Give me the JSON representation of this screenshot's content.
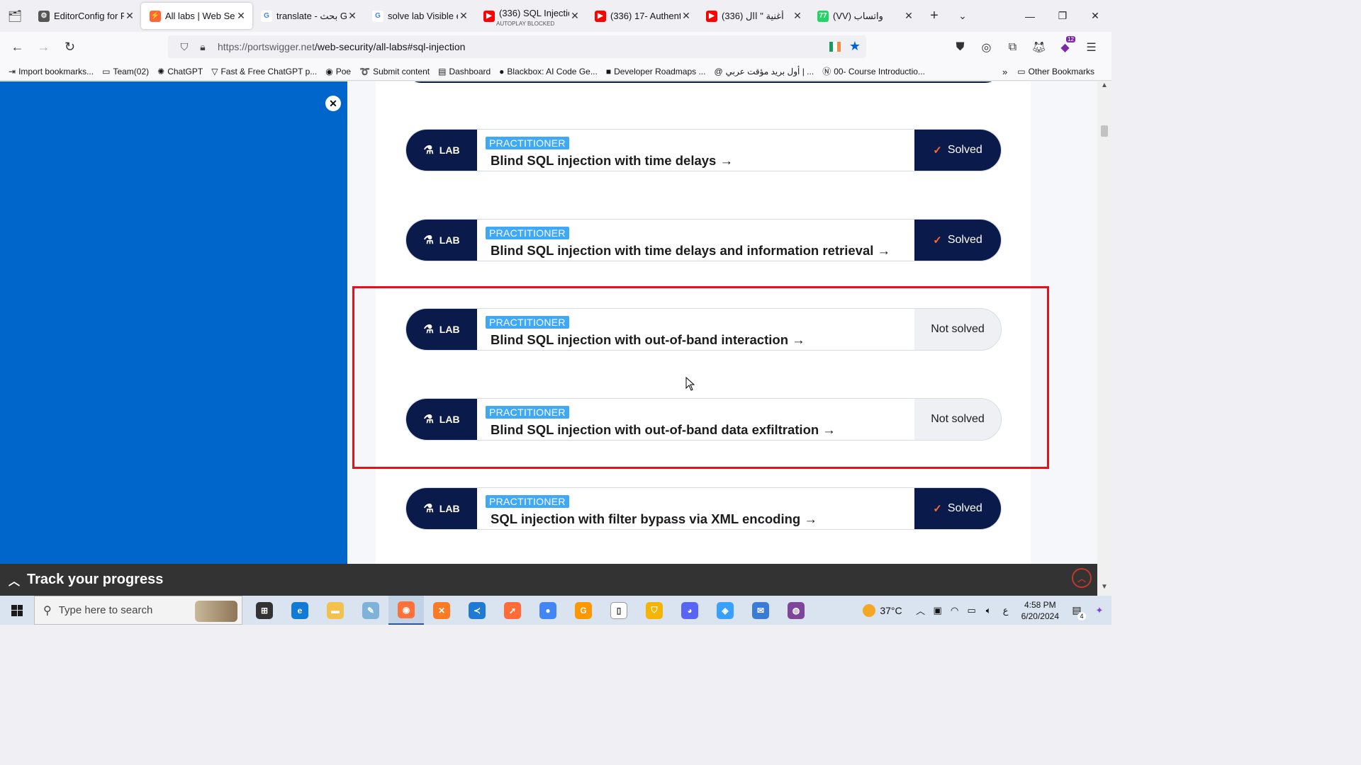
{
  "browser": {
    "tabs": [
      {
        "title": "EditorConfig for P",
        "favicon_color": "#555555",
        "glyph": "⚙"
      },
      {
        "title": "All labs | Web Sec",
        "favicon_color": "#ff6633",
        "glyph": "⚡",
        "active": true
      },
      {
        "title": "translate - بحث Go",
        "favicon_color": "#ffffff",
        "glyph": "G"
      },
      {
        "title": "solve lab Visible e",
        "favicon_color": "#ffffff",
        "glyph": "G"
      },
      {
        "title": "(336) SQL Injectio",
        "subtitle": "AUTOPLAY BLOCKED",
        "favicon_color": "#ff0000",
        "glyph": "▶"
      },
      {
        "title": "(336) 17- Authenti",
        "favicon_color": "#ff0000",
        "glyph": "▶"
      },
      {
        "title": "(336) أغنية \" اال",
        "favicon_color": "#ff0000",
        "glyph": "▶"
      },
      {
        "title": "(VV) واتساب",
        "favicon_color": "#25d366",
        "glyph": "77"
      }
    ],
    "url_host": "https://portswigger.net",
    "url_path": "/web-security/all-labs#sql-injection",
    "extensions_badge": "12",
    "bookmarks": [
      {
        "label": "Import bookmarks...",
        "icon": "⇥"
      },
      {
        "label": "Team(02)",
        "icon": "▭"
      },
      {
        "label": "ChatGPT",
        "icon": "✺"
      },
      {
        "label": "Fast & Free ChatGPT p...",
        "icon": "▽"
      },
      {
        "label": "Poe",
        "icon": "◉"
      },
      {
        "label": "Submit content",
        "icon": "➰"
      },
      {
        "label": "Dashboard",
        "icon": "▤"
      },
      {
        "label": "Blackbox: AI Code Ge...",
        "icon": "●"
      },
      {
        "label": "Developer Roadmaps ...",
        "icon": "■"
      },
      {
        "label": "أول بريد مؤقت عربي | ...",
        "icon": "@"
      },
      {
        "label": "00- Course Introductio...",
        "icon": "Ⓝ"
      }
    ],
    "other_bookmarks": "Other Bookmarks"
  },
  "labs": [
    {
      "tag": "LAB",
      "level": "PRACTITIONER",
      "name": "Blind SQL injection with time delays →",
      "status": "Solved",
      "solved": true
    },
    {
      "tag": "LAB",
      "level": "PRACTITIONER",
      "name": "Blind SQL injection with time delays and information retrieval →",
      "status": "Solved",
      "solved": true
    },
    {
      "tag": "LAB",
      "level": "PRACTITIONER",
      "name": "Blind SQL injection with out-of-band interaction →",
      "status": "Not solved",
      "solved": false
    },
    {
      "tag": "LAB",
      "level": "PRACTITIONER",
      "name": "Blind SQL injection with out-of-band data exfiltration →",
      "status": "Not solved",
      "solved": false
    },
    {
      "tag": "LAB",
      "level": "PRACTITIONER",
      "name": "SQL injection with filter bypass via XML encoding →",
      "status": "Solved",
      "solved": true
    }
  ],
  "track": {
    "label": "Track your progress"
  },
  "taskbar": {
    "search_placeholder": "Type here to search",
    "weather": "37°C",
    "time": "4:58 PM",
    "date": "6/20/2024",
    "lang": "ع",
    "notifications": "4",
    "apps": [
      {
        "name": "task-view",
        "color": "#333333",
        "glyph": "⊞"
      },
      {
        "name": "edge",
        "color": "#0f7bd6",
        "glyph": "e"
      },
      {
        "name": "file-explorer",
        "color": "#f2c14e",
        "glyph": "▬"
      },
      {
        "name": "notepad-plus",
        "color": "#7fb2d9",
        "glyph": "✎"
      },
      {
        "name": "firefox",
        "color": "#ff7139",
        "glyph": "◉",
        "active": true
      },
      {
        "name": "xampp",
        "color": "#fb7a24",
        "glyph": "✕"
      },
      {
        "name": "vscode",
        "color": "#1f7ad3",
        "glyph": "≺"
      },
      {
        "name": "postman",
        "color": "#ff6c37",
        "glyph": "➚"
      },
      {
        "name": "chrome",
        "color": "#4285f4",
        "glyph": "●"
      },
      {
        "name": "sublime",
        "color": "#ff9800",
        "glyph": "G"
      },
      {
        "name": "notepad",
        "color": "#ffffff",
        "glyph": "▯"
      },
      {
        "name": "bitwarden",
        "color": "#f4b400",
        "glyph": "⛉"
      },
      {
        "name": "discord",
        "color": "#5865f2",
        "glyph": "◕"
      },
      {
        "name": "network-app",
        "color": "#3aa0ff",
        "glyph": "◈"
      },
      {
        "name": "mail",
        "color": "#3a7bd5",
        "glyph": "✉"
      },
      {
        "name": "tor",
        "color": "#7d4698",
        "glyph": "◍"
      }
    ]
  }
}
